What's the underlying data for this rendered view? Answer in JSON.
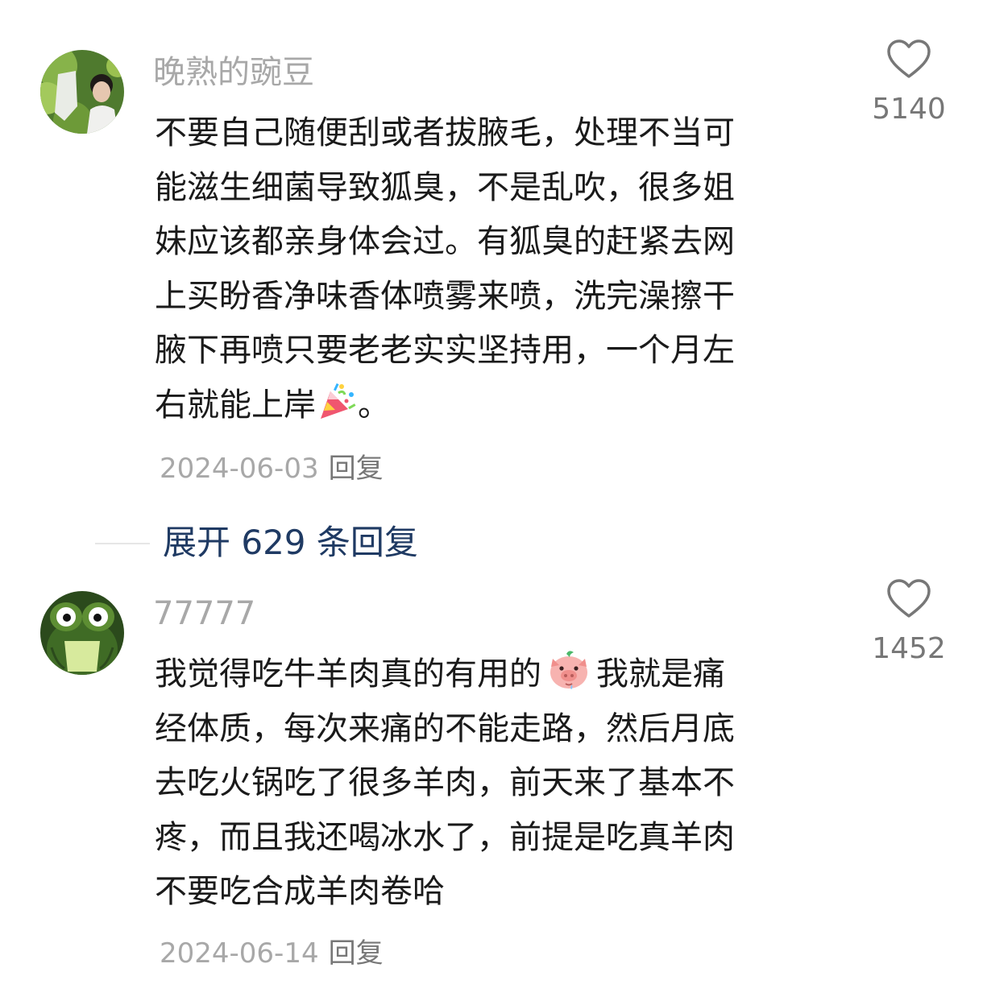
{
  "comments": [
    {
      "username": "晚熟的豌豆",
      "lines": [
        "不要自己随便刮或者拔腋毛，处理不当可",
        "能滋生细菌导致狐臭，不是乱吹，很多姐",
        "妹应该都亲身体会过。有狐臭的赶紧去网",
        "上买盼香净味香体喷雾来喷，洗完澡擦干",
        "腋下再喷只要老老实实坚持用，一个月左"
      ],
      "last_line_pre": "右就能上岸",
      "last_line_post": "。",
      "emoji": "party-popper-icon",
      "date": "2024-06-03",
      "reply_label": "回复",
      "likes": "5140"
    },
    {
      "username": "77777",
      "first_line_pre": "我觉得吃牛羊肉真的有用的",
      "first_line_post": "我就是痛",
      "emoji": "pig-face-icon",
      "lines": [
        "经体质，每次来痛的不能走路，然后月底",
        "去吃火锅吃了很多羊肉，前天来了基本不",
        "疼，而且我还喝冰水了，前提是吃真羊肉",
        "不要吃合成羊肉卷哈"
      ],
      "date": "2024-06-14",
      "reply_label": "回复",
      "likes": "1452"
    }
  ],
  "expand_replies": "展开 629 条回复",
  "colors": {
    "username": "#a8a8a8",
    "content": "#1a1a1a",
    "meta": "#a8a8a8",
    "expand_link": "#1f3a63"
  }
}
